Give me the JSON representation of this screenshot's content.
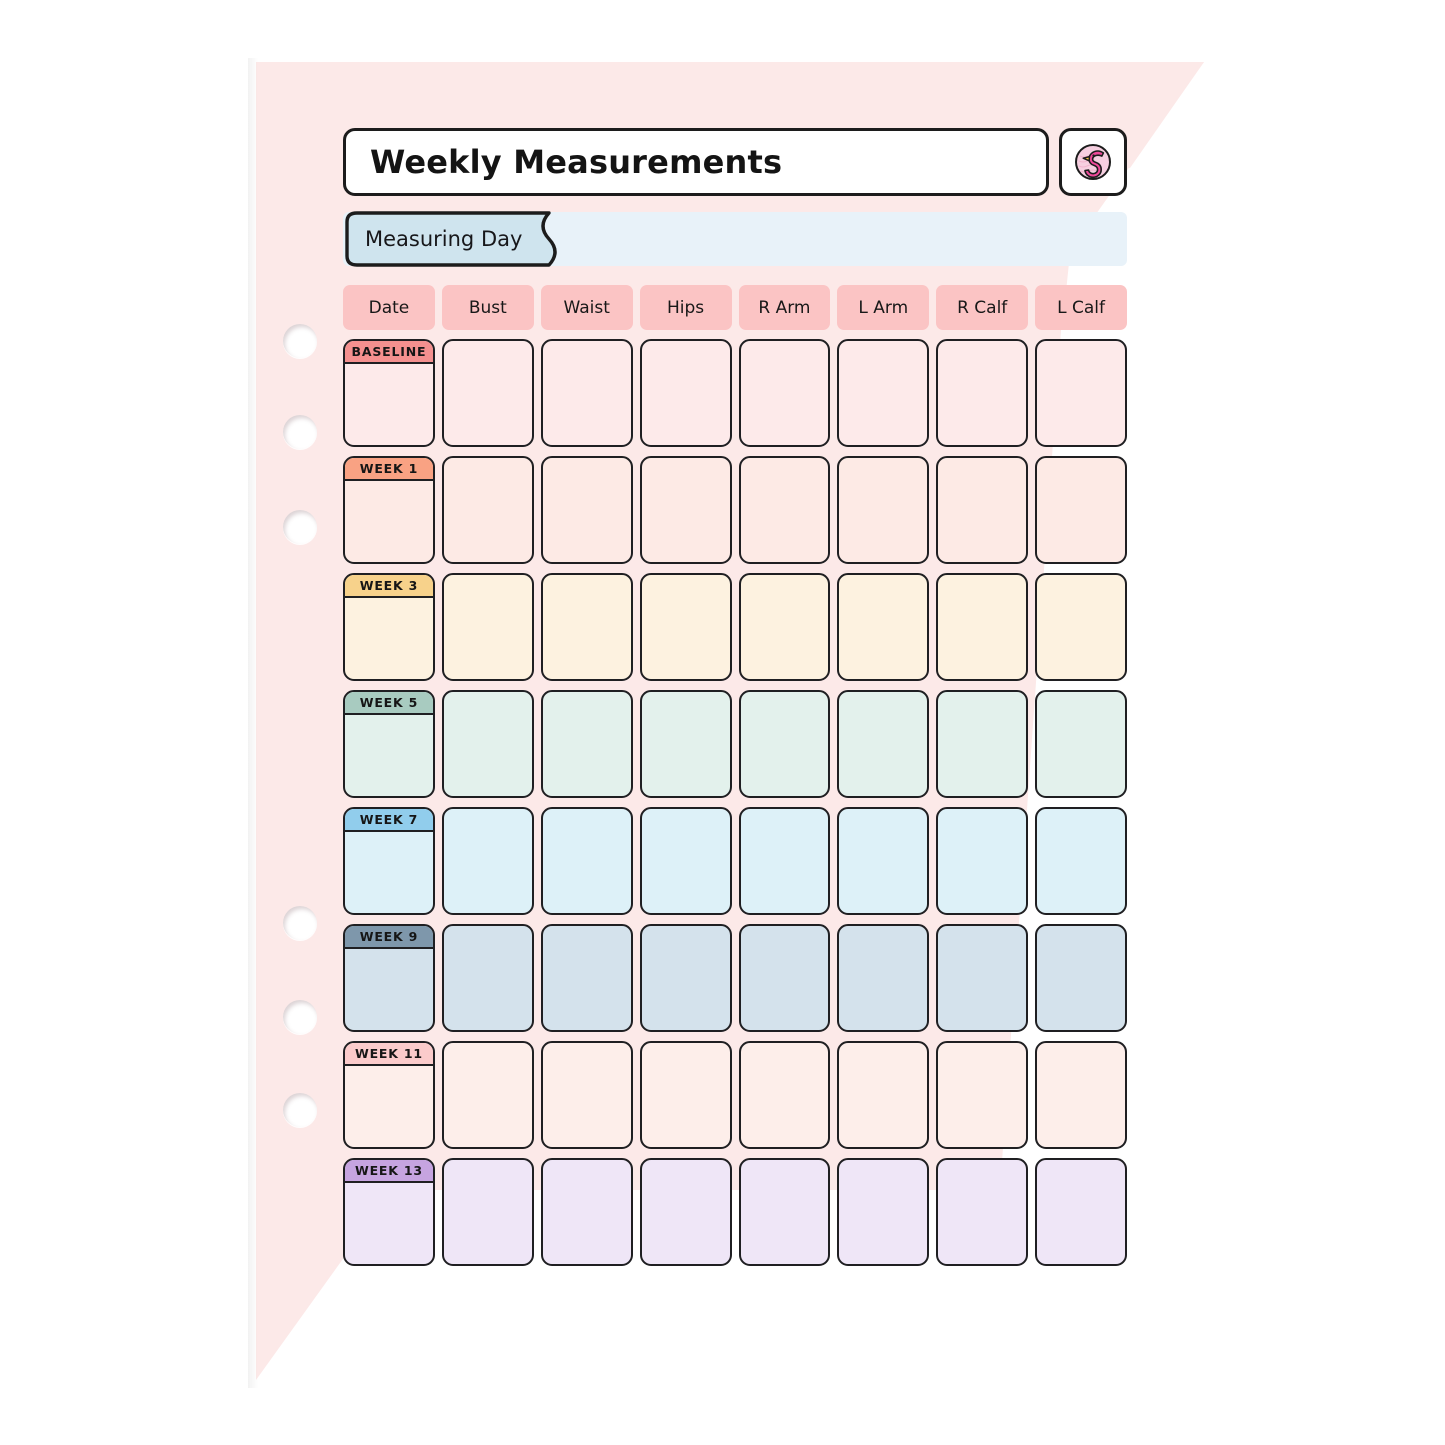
{
  "page": {
    "title": "Weekly Measurements",
    "logo_icon": "flamingo-icon",
    "background_color": "#fce9e8",
    "paper_color": "#ffffff",
    "holes": 6
  },
  "measuring_day": {
    "label": "Measuring Day",
    "tab_color": "#cfe4ee",
    "strip_color": "#e8f2f9",
    "value": ""
  },
  "table": {
    "header_color": "#fbc4c4",
    "columns": [
      {
        "label": "Date"
      },
      {
        "label": "Bust"
      },
      {
        "label": "Waist"
      },
      {
        "label": "Hips"
      },
      {
        "label": "R Arm"
      },
      {
        "label": "L Arm"
      },
      {
        "label": "R Calf"
      },
      {
        "label": "L Calf"
      }
    ],
    "rows": [
      {
        "label": "BASELINE",
        "tab_color": "#f4908f",
        "cell_color": "#fdeaea",
        "values": [
          "",
          "",
          "",
          "",
          "",
          "",
          ""
        ]
      },
      {
        "label": "WEEK 1",
        "tab_color": "#f9a283",
        "cell_color": "#fdeae5",
        "values": [
          "",
          "",
          "",
          "",
          "",
          "",
          ""
        ]
      },
      {
        "label": "WEEK 3",
        "tab_color": "#f7d28b",
        "cell_color": "#fdf2e0",
        "values": [
          "",
          "",
          "",
          "",
          "",
          "",
          ""
        ]
      },
      {
        "label": "WEEK 5",
        "tab_color": "#a8cbc0",
        "cell_color": "#e3f1ec",
        "values": [
          "",
          "",
          "",
          "",
          "",
          "",
          ""
        ]
      },
      {
        "label": "WEEK 7",
        "tab_color": "#91cdec",
        "cell_color": "#ddf1f8",
        "values": [
          "",
          "",
          "",
          "",
          "",
          "",
          ""
        ]
      },
      {
        "label": "WEEK 9",
        "tab_color": "#7e97ab",
        "cell_color": "#d4e2ec",
        "values": [
          "",
          "",
          "",
          "",
          "",
          "",
          ""
        ]
      },
      {
        "label": "WEEK 11",
        "tab_color": "#fbcbcb",
        "cell_color": "#fdeeea",
        "values": [
          "",
          "",
          "",
          "",
          "",
          "",
          ""
        ]
      },
      {
        "label": "WEEK 13",
        "tab_color": "#c6a4e0",
        "cell_color": "#efe6f7",
        "values": [
          "",
          "",
          "",
          "",
          "",
          "",
          ""
        ]
      }
    ]
  }
}
